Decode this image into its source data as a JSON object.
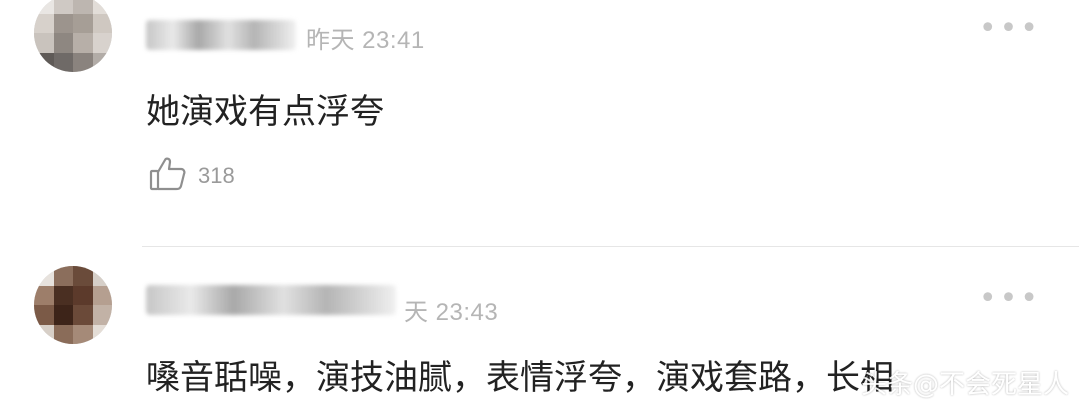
{
  "comments": [
    {
      "time": "昨天 23:41",
      "text": "她演戏有点浮夸",
      "likes": "318",
      "more": "•••"
    },
    {
      "time": "天 23:43",
      "text": "嗓音聒噪，演技油腻，表情浮夸，演戏套路，长相",
      "more": "•••"
    }
  ],
  "watermark": "头条@不会死星人",
  "icons": {
    "like": "thumbs-up-icon",
    "more": "more-options-icon"
  }
}
